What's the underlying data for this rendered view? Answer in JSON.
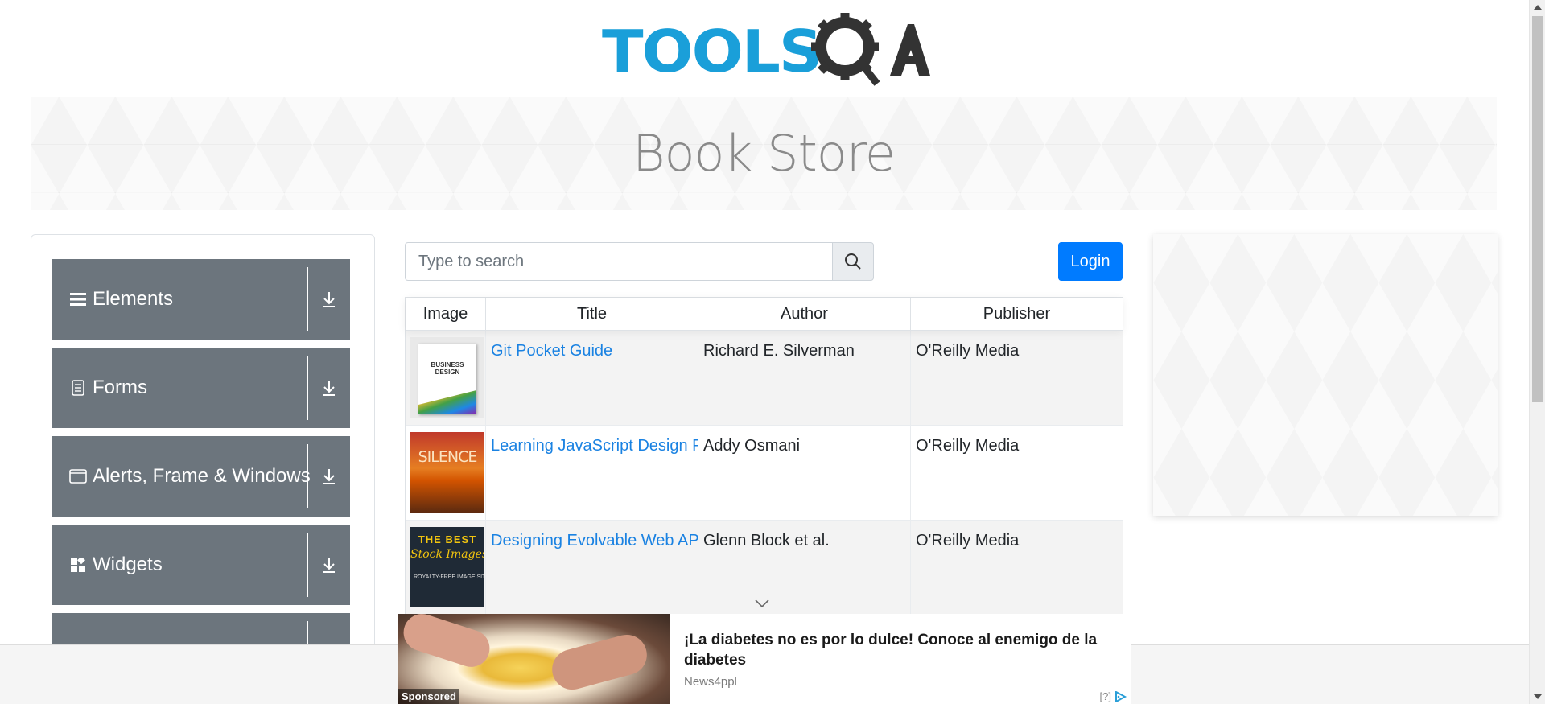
{
  "header": {
    "logo_text": "TOOLSQA",
    "logo_part_tools": "TOOLS",
    "logo_part_qa": "QA",
    "brand_blue": "#1a9fd9",
    "brand_dark": "#333333"
  },
  "banner": {
    "title": "Book Store"
  },
  "sidebar": {
    "groups": [
      {
        "label": "Elements",
        "icon": "hamburger-icon"
      },
      {
        "label": "Forms",
        "icon": "document-icon"
      },
      {
        "label": "Alerts, Frame & Windows",
        "icon": "window-icon"
      },
      {
        "label": "Widgets",
        "icon": "widgets-icon"
      },
      {
        "label": "",
        "icon": ""
      }
    ],
    "expand_icon": "download-arrow-icon",
    "group_color": "#6c757d"
  },
  "search": {
    "placeholder": "Type to search",
    "value": "",
    "button_icon": "search-icon"
  },
  "login": {
    "label": "Login",
    "color": "#007bff"
  },
  "table": {
    "headers": [
      "Image",
      "Title",
      "Author",
      "Publisher"
    ],
    "rows": [
      {
        "title": "Git Pocket Guide",
        "author": "Richard E. Silverman",
        "publisher": "O'Reilly Media",
        "cover_text": [
          "BUSINESS",
          "DESIGN"
        ]
      },
      {
        "title": "Learning JavaScript Design Patterns",
        "author": "Addy Osmani",
        "publisher": "O'Reilly Media",
        "cover_text": [
          "SILENCE"
        ]
      },
      {
        "title": "Designing Evolvable Web APIs with ASP.NET",
        "author": "Glenn Block et al.",
        "publisher": "O'Reilly Media",
        "cover_text": [
          "THE BEST",
          "Stock Images",
          "ROYALTY-FREE IMAGE SITES FOR BOOK COVERS"
        ]
      }
    ]
  },
  "ad": {
    "title": "¡La diabetes no es por lo dulce! Conoce al enemigo de la diabetes",
    "source": "News4ppl",
    "sponsored": "Sponsored",
    "info": "[?]"
  }
}
